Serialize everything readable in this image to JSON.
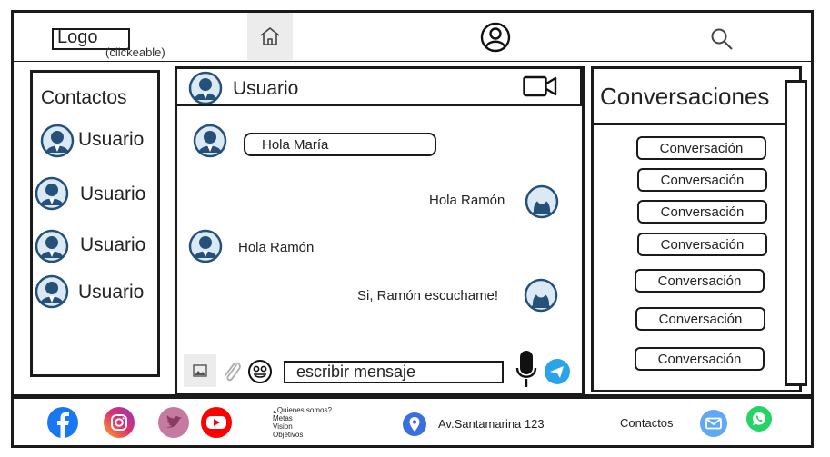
{
  "header": {
    "logo_label": "Logo",
    "logo_note": "(clickeable)"
  },
  "contacts": {
    "title": "Contactos",
    "items": [
      {
        "label": "Usuario"
      },
      {
        "label": "Usuario"
      },
      {
        "label": "Usuario"
      },
      {
        "label": "Usuario"
      }
    ]
  },
  "chat": {
    "header_name": "Usuario",
    "messages": [
      {
        "text": "Hola María",
        "side": "left"
      },
      {
        "text": "Hola Ramón",
        "side": "right"
      },
      {
        "text": "Hola Ramón",
        "side": "left"
      },
      {
        "text": "Si, Ramón escuchame!",
        "side": "right"
      }
    ],
    "input_placeholder": "escribir mensaje"
  },
  "conversations": {
    "title": "Conversaciones",
    "items": [
      "Conversación",
      "Conversación",
      "Conversación",
      "Conversación",
      "Conversación",
      "Conversación",
      "Conversación"
    ]
  },
  "footer": {
    "about_links": [
      "¿Quienes somos?",
      "Metas",
      "Vision",
      "Objetivos"
    ],
    "address": "Av.Santamarina 123",
    "contacts_label": "Contactos"
  },
  "colors": {
    "facebook": "#1877f2",
    "instagram": "#e1306c",
    "twitter_tint": "#c77aa0",
    "youtube": "#ff0000",
    "location": "#3b6fe0",
    "whatsapp": "#25d366",
    "mail": "#5fa8f5",
    "send": "#2aa3e8"
  }
}
